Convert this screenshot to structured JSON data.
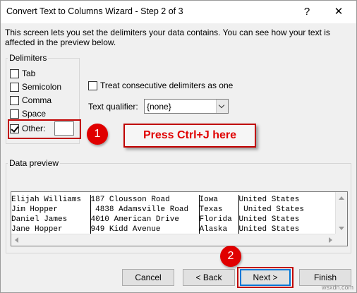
{
  "window": {
    "title": "Convert Text to Columns Wizard - Step 2 of 3",
    "help": "?",
    "close": "✕"
  },
  "description": "This screen lets you set the delimiters your data contains.  You can see how your text is affected in the preview below.",
  "delimiters": {
    "title": "Delimiters",
    "items": [
      {
        "label": "Tab",
        "checked": false
      },
      {
        "label": "Semicolon",
        "checked": false
      },
      {
        "label": "Comma",
        "checked": false
      },
      {
        "label": "Space",
        "checked": false
      },
      {
        "label": "Other:",
        "checked": true
      }
    ],
    "other_value": ""
  },
  "consecutive": {
    "label": "Treat consecutive delimiters as one",
    "checked": false
  },
  "qualifier": {
    "label": "Text qualifier:",
    "value": "{none}"
  },
  "annotations": {
    "step1": "1",
    "step2": "2",
    "callout": "Press Ctrl+J here",
    "accent": "#e00000"
  },
  "preview": {
    "title": "Data preview",
    "rows": [
      [
        "Elijah Williams",
        "187 Clousson Road",
        "Iowa",
        "United States"
      ],
      [
        "Jim Hopper",
        " 4838 Adamsville Road",
        "Texas",
        " United States"
      ],
      [
        "Daniel James",
        "4010 American Drive",
        "Florida",
        "United States"
      ],
      [
        "Jane Hopper",
        "949 Kidd Avenue",
        "Alaska",
        "United States"
      ]
    ]
  },
  "buttons": {
    "cancel": "Cancel",
    "back": "< Back",
    "next": "Next >",
    "finish": "Finish"
  },
  "watermark": "wsxdn.com"
}
